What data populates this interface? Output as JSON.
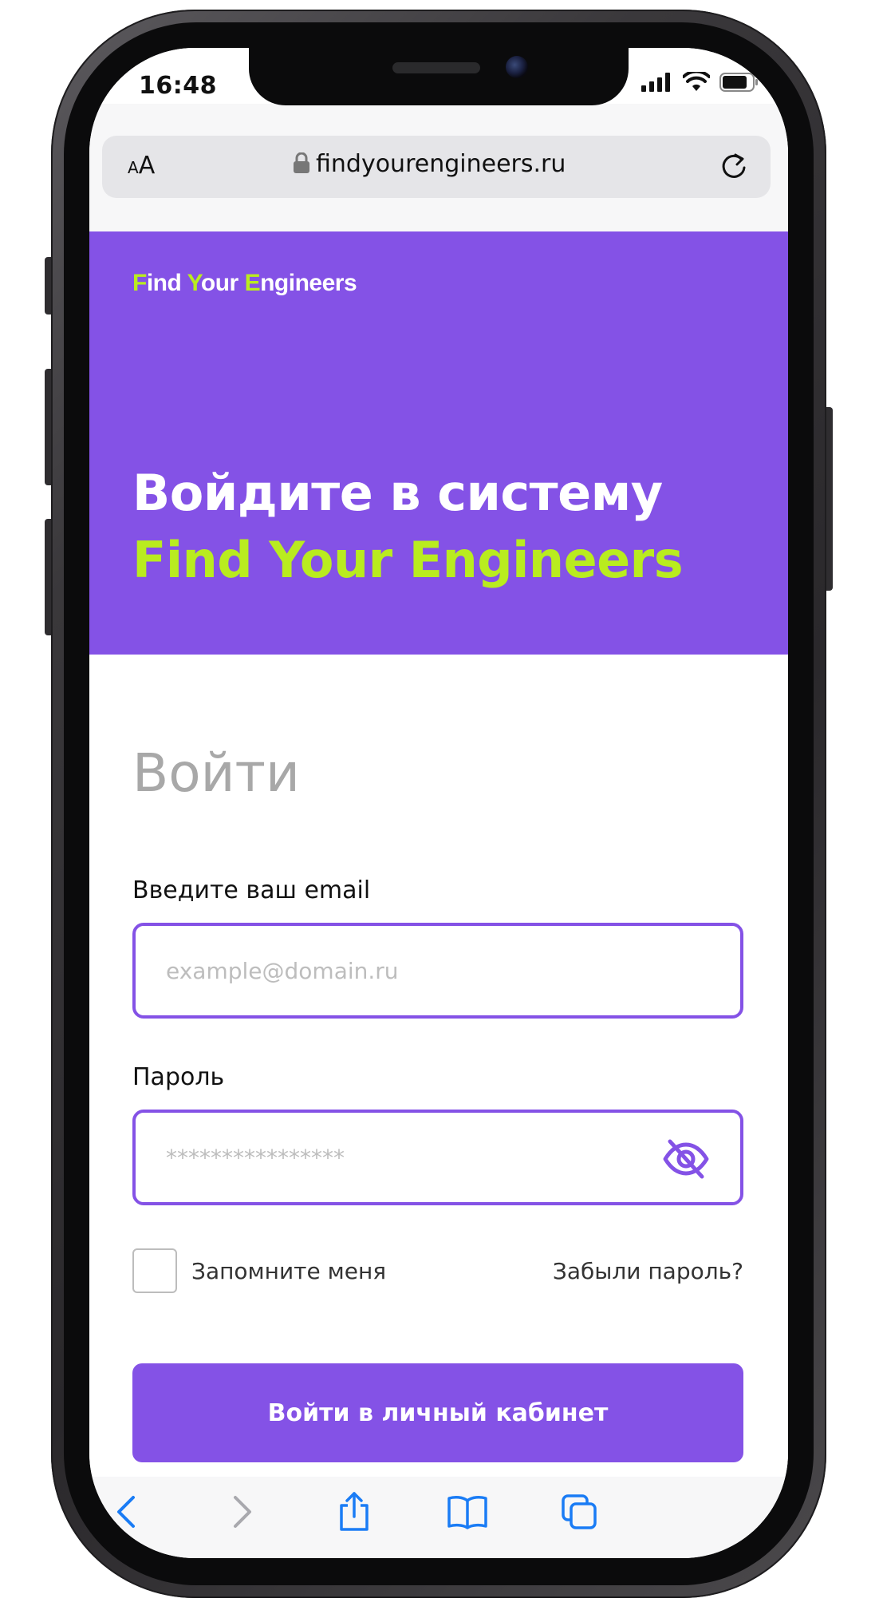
{
  "status_bar": {
    "time": "16:48"
  },
  "browser": {
    "text_size_small": "A",
    "text_size_big": "A",
    "url": "findyourengineers.ru"
  },
  "hero": {
    "logo_part1": "F",
    "logo_part2": "ind ",
    "logo_part3": "Y",
    "logo_part4": "our ",
    "logo_part5": "E",
    "logo_part6": "ngineers",
    "title_line1": "Войдите в систему",
    "title_line2": "Find Your Engineers"
  },
  "form": {
    "title": "Войти",
    "email_label": "Введите ваш email",
    "email_placeholder": "example@domain.ru",
    "password_label": "Пароль",
    "password_placeholder": "****************",
    "remember_label": "Запомните меня",
    "forgot_link": "Забыли пароль?",
    "submit_label": "Войти в личный кабинет"
  },
  "toolbar": {
    "back_icon": "chevron-left-icon",
    "forward_icon": "chevron-right-icon",
    "share_icon": "share-icon",
    "bookmarks_icon": "book-icon",
    "tabs_icon": "tabs-icon"
  },
  "colors": {
    "brand_purple": "#8452e6",
    "accent_green": "#b9ec1f",
    "ios_blue": "#1a7cf5"
  }
}
